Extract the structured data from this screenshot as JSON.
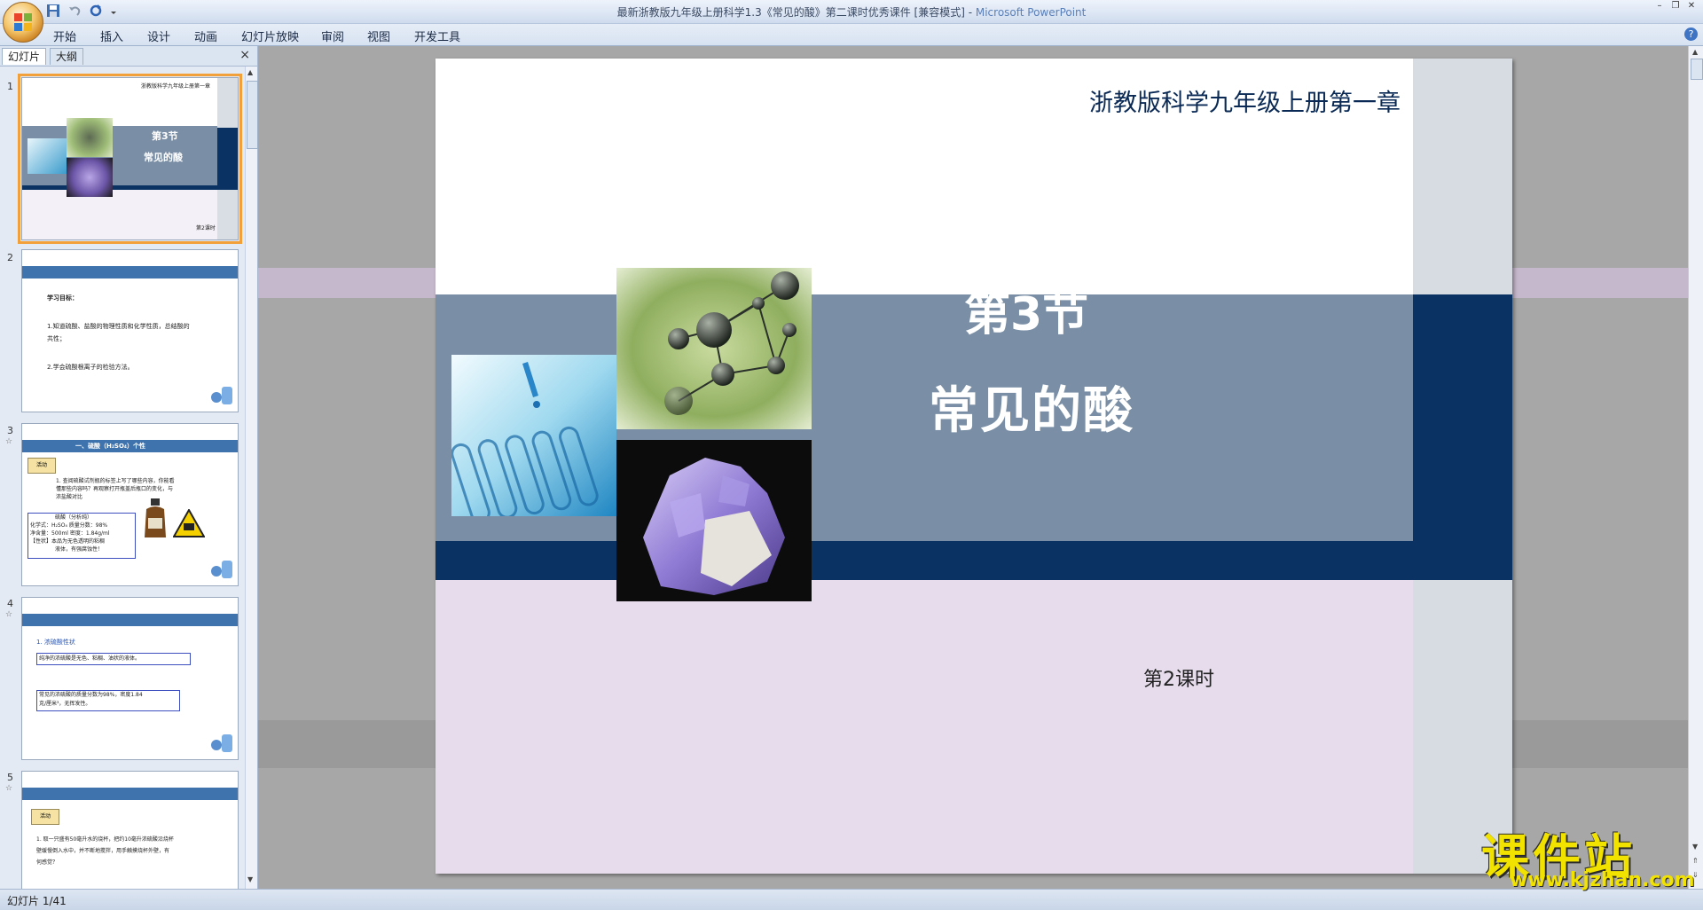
{
  "window": {
    "title": "最新浙教版九年级上册科学1.3《常见的酸》第二课时优秀课件 [兼容模式] - ",
    "app_name": "Microsoft PowerPoint"
  },
  "ribbon": {
    "tabs": [
      "开始",
      "插入",
      "设计",
      "动画",
      "幻灯片放映",
      "审阅",
      "视图",
      "开发工具"
    ]
  },
  "panel": {
    "tab_slides": "幻灯片",
    "tab_outline": "大纲",
    "close": "×"
  },
  "thumbnails": [
    {
      "num": "1",
      "header": "浙教版科学九年级上册第一章",
      "section": "第3节",
      "title": "常见的酸",
      "footer": "第2课时"
    },
    {
      "num": "2",
      "heading": "学习目标：",
      "lines": [
        "1.知道硫酸、盐酸的物理性质和化学性质，总结酸的",
        "共性；",
        "2.学会硫酸根离子的检验方法。"
      ]
    },
    {
      "num": "3",
      "title": "一、硫酸（H₂SO₄）个性",
      "badge": "活动",
      "lines": [
        "1. 查阅硫酸试剂瓶的标签上写了哪些内容，你能看",
        "懂那些内容吗？再观察打开瓶盖后瓶口的变化，与",
        "浓盐酸对比"
      ],
      "label_lines": [
        "硫酸（分析纯）",
        "化学式：H₂SO₄   质量分数：98%",
        "净含量：500ml   密度：1.84g/ml",
        "【性状】本品为无色透明的粘稠",
        "液体，有强腐蚀性！"
      ]
    },
    {
      "num": "4",
      "heading": "1. 浓硫酸性状",
      "box1": "纯净的浓硫酸是无色、粘稠、油状的液体。",
      "box2": [
        "常见的浓硫酸的质量分数为98%，密度1.84",
        "克/厘米³，无挥发性。"
      ]
    },
    {
      "num": "5",
      "badge": "活动",
      "lines": [
        "1. 取一只盛有50毫升水的烧杯，把约10毫升浓硫酸沿烧杯",
        "壁缓慢倒入水中，并不断地搅拌，用手触摸烧杯外壁，有",
        "何感觉？"
      ]
    }
  ],
  "slide": {
    "header": "浙教版科学九年级上册第一章",
    "section": "第3节",
    "title": "常见的酸",
    "footer": "第2课时"
  },
  "status": {
    "slide_indicator": "幻灯片 1/41"
  },
  "watermark": {
    "name": "课件站",
    "url": "www.kjzhan.com"
  },
  "colors": {
    "navy_band": "#0a3262",
    "blue_gray_band": "#7a8fa6",
    "lavender": "#e6dcec",
    "right_gutter": "#d7dbe2",
    "thumb_selected": "#f2a03a"
  }
}
